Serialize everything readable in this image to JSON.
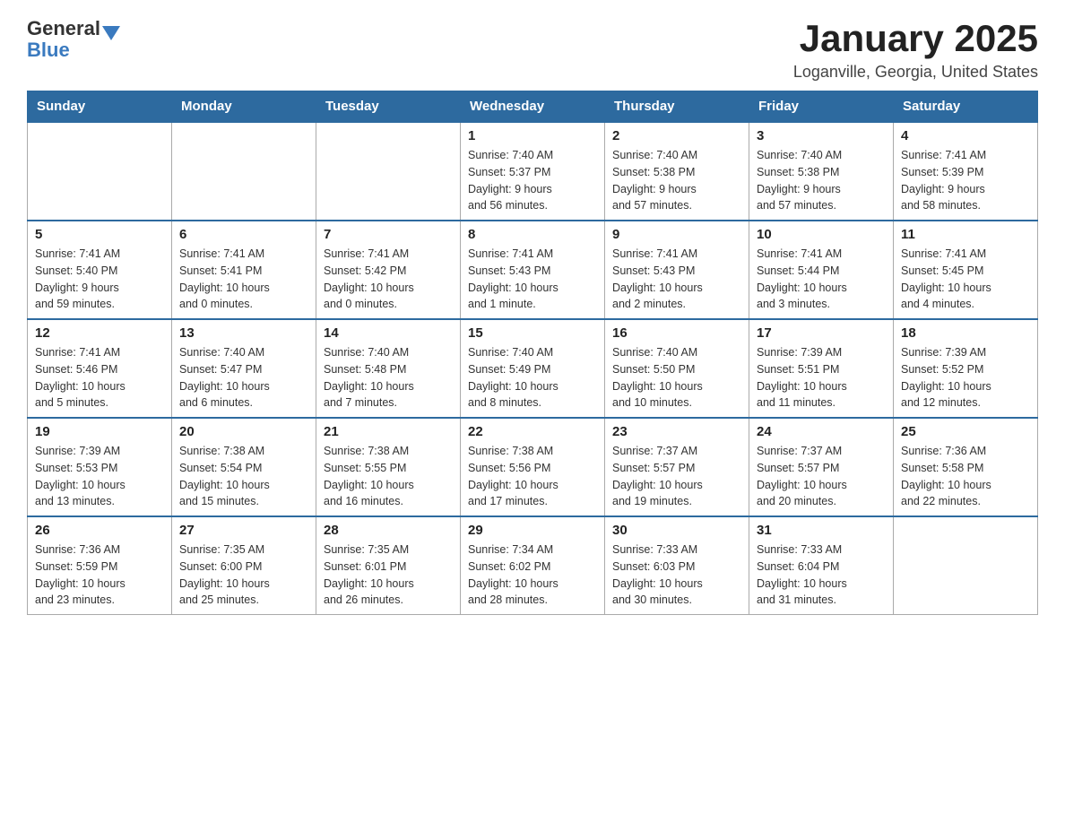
{
  "header": {
    "logo_general": "General",
    "logo_blue": "Blue",
    "title": "January 2025",
    "subtitle": "Loganville, Georgia, United States"
  },
  "days_of_week": [
    "Sunday",
    "Monday",
    "Tuesday",
    "Wednesday",
    "Thursday",
    "Friday",
    "Saturday"
  ],
  "weeks": [
    [
      {
        "day": "",
        "info": ""
      },
      {
        "day": "",
        "info": ""
      },
      {
        "day": "",
        "info": ""
      },
      {
        "day": "1",
        "info": "Sunrise: 7:40 AM\nSunset: 5:37 PM\nDaylight: 9 hours\nand 56 minutes."
      },
      {
        "day": "2",
        "info": "Sunrise: 7:40 AM\nSunset: 5:38 PM\nDaylight: 9 hours\nand 57 minutes."
      },
      {
        "day": "3",
        "info": "Sunrise: 7:40 AM\nSunset: 5:38 PM\nDaylight: 9 hours\nand 57 minutes."
      },
      {
        "day": "4",
        "info": "Sunrise: 7:41 AM\nSunset: 5:39 PM\nDaylight: 9 hours\nand 58 minutes."
      }
    ],
    [
      {
        "day": "5",
        "info": "Sunrise: 7:41 AM\nSunset: 5:40 PM\nDaylight: 9 hours\nand 59 minutes."
      },
      {
        "day": "6",
        "info": "Sunrise: 7:41 AM\nSunset: 5:41 PM\nDaylight: 10 hours\nand 0 minutes."
      },
      {
        "day": "7",
        "info": "Sunrise: 7:41 AM\nSunset: 5:42 PM\nDaylight: 10 hours\nand 0 minutes."
      },
      {
        "day": "8",
        "info": "Sunrise: 7:41 AM\nSunset: 5:43 PM\nDaylight: 10 hours\nand 1 minute."
      },
      {
        "day": "9",
        "info": "Sunrise: 7:41 AM\nSunset: 5:43 PM\nDaylight: 10 hours\nand 2 minutes."
      },
      {
        "day": "10",
        "info": "Sunrise: 7:41 AM\nSunset: 5:44 PM\nDaylight: 10 hours\nand 3 minutes."
      },
      {
        "day": "11",
        "info": "Sunrise: 7:41 AM\nSunset: 5:45 PM\nDaylight: 10 hours\nand 4 minutes."
      }
    ],
    [
      {
        "day": "12",
        "info": "Sunrise: 7:41 AM\nSunset: 5:46 PM\nDaylight: 10 hours\nand 5 minutes."
      },
      {
        "day": "13",
        "info": "Sunrise: 7:40 AM\nSunset: 5:47 PM\nDaylight: 10 hours\nand 6 minutes."
      },
      {
        "day": "14",
        "info": "Sunrise: 7:40 AM\nSunset: 5:48 PM\nDaylight: 10 hours\nand 7 minutes."
      },
      {
        "day": "15",
        "info": "Sunrise: 7:40 AM\nSunset: 5:49 PM\nDaylight: 10 hours\nand 8 minutes."
      },
      {
        "day": "16",
        "info": "Sunrise: 7:40 AM\nSunset: 5:50 PM\nDaylight: 10 hours\nand 10 minutes."
      },
      {
        "day": "17",
        "info": "Sunrise: 7:39 AM\nSunset: 5:51 PM\nDaylight: 10 hours\nand 11 minutes."
      },
      {
        "day": "18",
        "info": "Sunrise: 7:39 AM\nSunset: 5:52 PM\nDaylight: 10 hours\nand 12 minutes."
      }
    ],
    [
      {
        "day": "19",
        "info": "Sunrise: 7:39 AM\nSunset: 5:53 PM\nDaylight: 10 hours\nand 13 minutes."
      },
      {
        "day": "20",
        "info": "Sunrise: 7:38 AM\nSunset: 5:54 PM\nDaylight: 10 hours\nand 15 minutes."
      },
      {
        "day": "21",
        "info": "Sunrise: 7:38 AM\nSunset: 5:55 PM\nDaylight: 10 hours\nand 16 minutes."
      },
      {
        "day": "22",
        "info": "Sunrise: 7:38 AM\nSunset: 5:56 PM\nDaylight: 10 hours\nand 17 minutes."
      },
      {
        "day": "23",
        "info": "Sunrise: 7:37 AM\nSunset: 5:57 PM\nDaylight: 10 hours\nand 19 minutes."
      },
      {
        "day": "24",
        "info": "Sunrise: 7:37 AM\nSunset: 5:57 PM\nDaylight: 10 hours\nand 20 minutes."
      },
      {
        "day": "25",
        "info": "Sunrise: 7:36 AM\nSunset: 5:58 PM\nDaylight: 10 hours\nand 22 minutes."
      }
    ],
    [
      {
        "day": "26",
        "info": "Sunrise: 7:36 AM\nSunset: 5:59 PM\nDaylight: 10 hours\nand 23 minutes."
      },
      {
        "day": "27",
        "info": "Sunrise: 7:35 AM\nSunset: 6:00 PM\nDaylight: 10 hours\nand 25 minutes."
      },
      {
        "day": "28",
        "info": "Sunrise: 7:35 AM\nSunset: 6:01 PM\nDaylight: 10 hours\nand 26 minutes."
      },
      {
        "day": "29",
        "info": "Sunrise: 7:34 AM\nSunset: 6:02 PM\nDaylight: 10 hours\nand 28 minutes."
      },
      {
        "day": "30",
        "info": "Sunrise: 7:33 AM\nSunset: 6:03 PM\nDaylight: 10 hours\nand 30 minutes."
      },
      {
        "day": "31",
        "info": "Sunrise: 7:33 AM\nSunset: 6:04 PM\nDaylight: 10 hours\nand 31 minutes."
      },
      {
        "day": "",
        "info": ""
      }
    ]
  ]
}
